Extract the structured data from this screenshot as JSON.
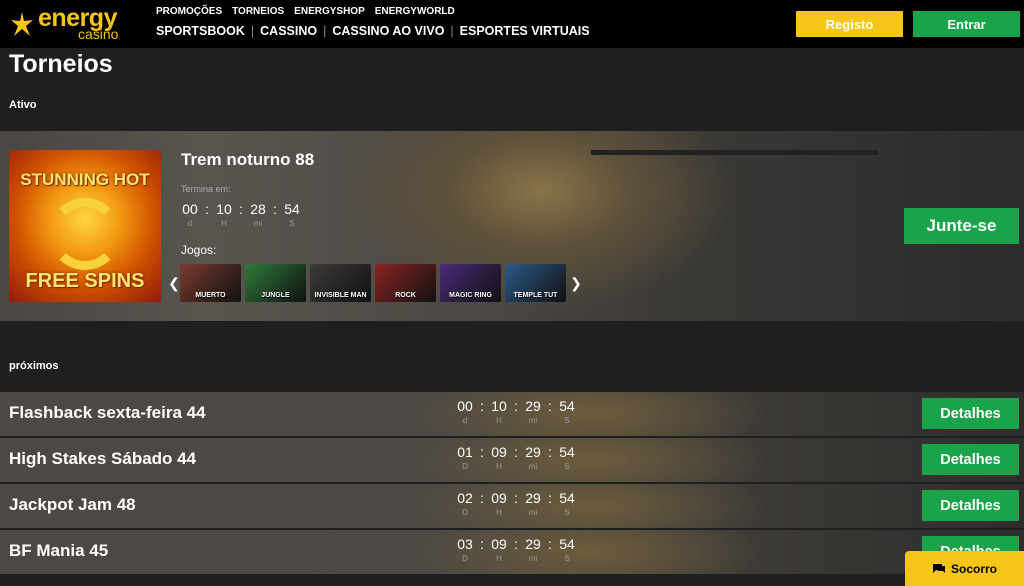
{
  "brand": {
    "name": "energy",
    "sub": "casino",
    "color": "#f5c518"
  },
  "nav": {
    "primary": [
      "PROMOÇÕES",
      "TORNEIOS",
      "ENERGYSHOP",
      "ENERGYWORLD"
    ],
    "secondary": [
      "SPORTSBOOK",
      "CASSINO",
      "CASSINO AO VIVO",
      "ESPORTES VIRTUAIS"
    ]
  },
  "auth": {
    "register": "Registo",
    "login": "Entrar"
  },
  "page": {
    "title": "Torneios",
    "active_heading": "Ativo",
    "upcoming_heading": "próximos"
  },
  "active": {
    "name": "Trem noturno 88",
    "ends_label": "Termina em:",
    "timer": {
      "d": "00",
      "h": "10",
      "m": "28",
      "s": "54"
    },
    "units": {
      "d": "d",
      "h": "H",
      "m": "mi",
      "s": "S"
    },
    "games_label": "Jogos:",
    "thumb": {
      "top": "STUNNING HOT",
      "bottom": "FREE SPINS"
    },
    "games": [
      {
        "label": "MUERTO",
        "bg": "#7a3b2e"
      },
      {
        "label": "JUNGLE",
        "bg": "#2f7a3a"
      },
      {
        "label": "INVISIBLE MAN",
        "bg": "#3b3b3b"
      },
      {
        "label": "ROCK",
        "bg": "#8b2323"
      },
      {
        "label": "MAGIC RING",
        "bg": "#4a2a7a"
      },
      {
        "label": "TEMPLE TUT",
        "bg": "#2a5a8a"
      }
    ],
    "join": "Junte-se"
  },
  "upcoming": [
    {
      "name": "Flashback sexta-feira 44",
      "timer": {
        "d": "00",
        "h": "10",
        "m": "29",
        "s": "54"
      },
      "units": {
        "d": "d",
        "h": "H",
        "m": "mi",
        "s": "S"
      },
      "button": "Detalhes"
    },
    {
      "name": "High Stakes Sábado 44",
      "timer": {
        "d": "01",
        "h": "09",
        "m": "29",
        "s": "54"
      },
      "units": {
        "d": "D",
        "h": "H",
        "m": "mi",
        "s": "S"
      },
      "button": "Detalhes"
    },
    {
      "name": "Jackpot Jam 48",
      "timer": {
        "d": "02",
        "h": "09",
        "m": "29",
        "s": "54"
      },
      "units": {
        "d": "D",
        "h": "H",
        "m": "mi",
        "s": "S"
      },
      "button": "Detalhes"
    },
    {
      "name": "BF Mania 45",
      "timer": {
        "d": "03",
        "h": "09",
        "m": "29",
        "s": "54"
      },
      "units": {
        "d": "D",
        "h": "H",
        "m": "mi",
        "s": "S"
      },
      "button": "Detalhes"
    }
  ],
  "help": {
    "label": "Socorro",
    "icon": "chat-icon"
  },
  "colors": {
    "green": "#1aa34a",
    "yellow": "#f5c518",
    "bg": "#1f1f1f"
  }
}
